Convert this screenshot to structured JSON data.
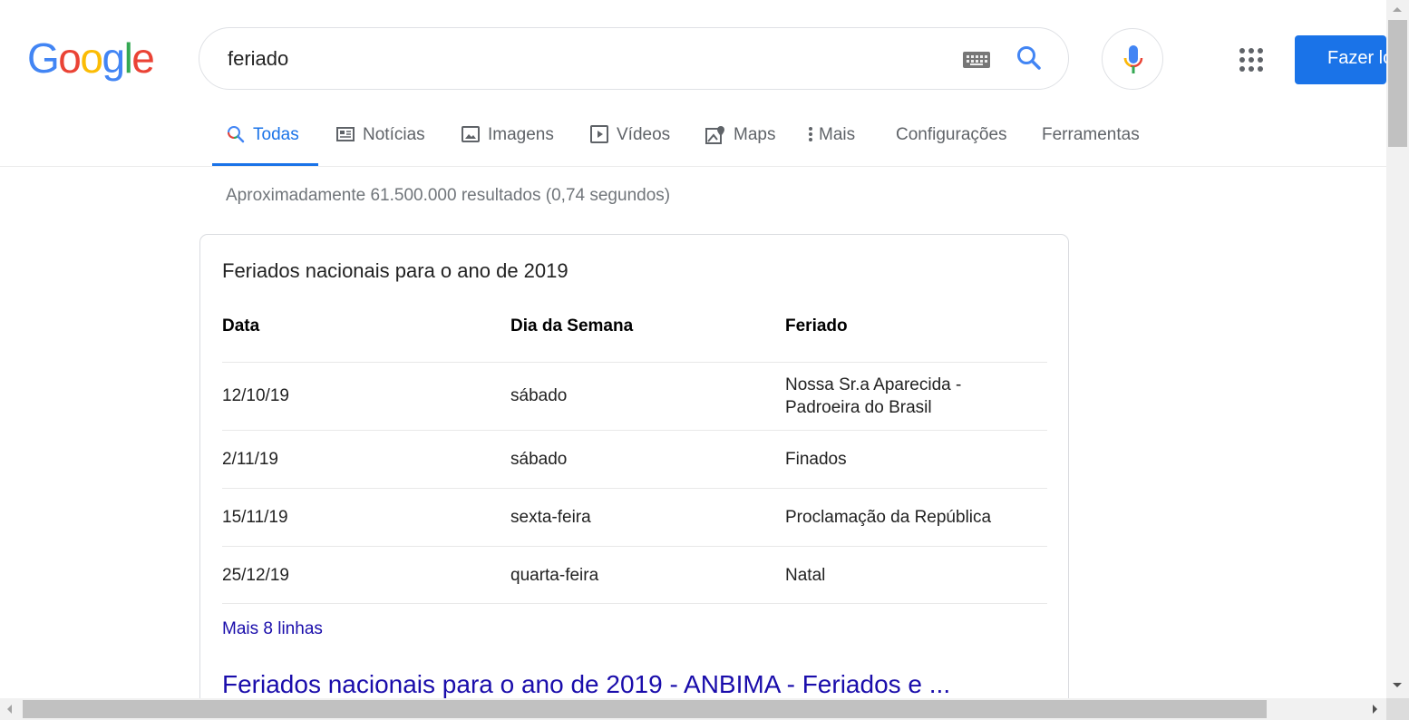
{
  "logo": {
    "letters": [
      "G",
      "o",
      "o",
      "g",
      "l",
      "e"
    ],
    "colors": [
      "#4285f4",
      "#ea4335",
      "#fbbc05",
      "#4285f4",
      "#34a853",
      "#ea4335"
    ]
  },
  "search": {
    "query": "feriado"
  },
  "header": {
    "signin_label": "Fazer login"
  },
  "tabs": [
    {
      "label": "Todas",
      "icon": "search-icon",
      "active": true
    },
    {
      "label": "Notícias",
      "icon": "newspaper-icon"
    },
    {
      "label": "Imagens",
      "icon": "image-icon"
    },
    {
      "label": "Vídeos",
      "icon": "play-icon"
    },
    {
      "label": "Maps",
      "icon": "map-pin-icon"
    },
    {
      "label": "Mais",
      "icon": "more-vertical-icon"
    },
    {
      "label": "Configurações"
    },
    {
      "label": "Ferramentas"
    }
  ],
  "stats": "Aproximadamente 61.500.000 resultados (0,74 segundos)",
  "card": {
    "title": "Feriados nacionais para o ano de 2019",
    "headers": [
      "Data",
      "Dia da Semana",
      "Feriado"
    ],
    "rows": [
      {
        "date": "12/10/19",
        "weekday": "sábado",
        "holiday_line1": "Nossa Sr.a Aparecida -",
        "holiday_line2": "Padroeira do Brasil"
      },
      {
        "date": "2/11/19",
        "weekday": "sábado",
        "holiday_line1": "Finados"
      },
      {
        "date": "15/11/19",
        "weekday": "sexta-feira",
        "holiday_line1": "Proclamação da República"
      },
      {
        "date": "25/12/19",
        "weekday": "quarta-feira",
        "holiday_line1": "Natal"
      }
    ],
    "more_link": "Mais 8 linhas",
    "result_title": "Feriados nacionais para o ano de 2019 - ANBIMA - Feriados e ..."
  },
  "colors": {
    "accent": "#1a73e8",
    "link": "#1a0dab",
    "muted": "#70757a"
  }
}
